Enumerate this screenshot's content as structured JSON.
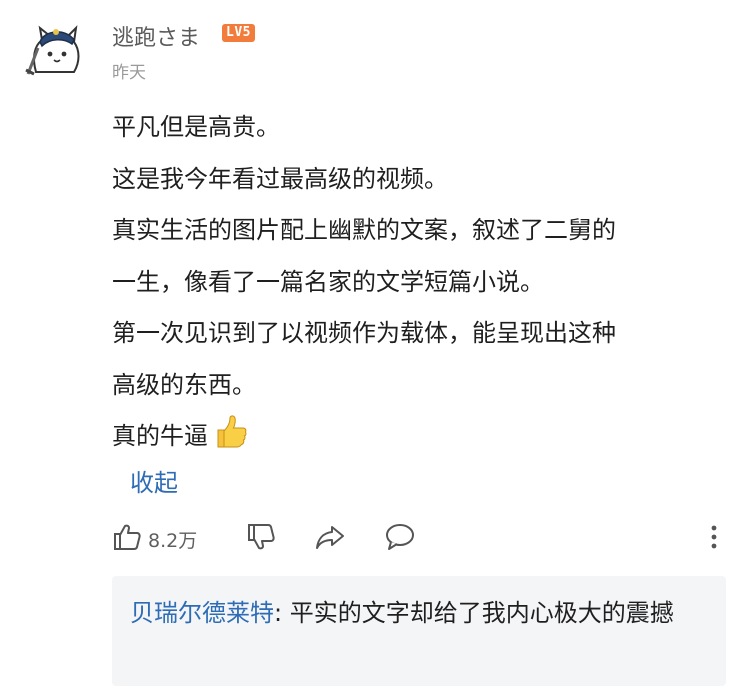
{
  "comment": {
    "username": "逃跑さま",
    "level_badge": "LV5",
    "timestamp": "昨天",
    "lines": [
      "平凡但是高贵。",
      "这是我今年看过最高级的视频。",
      "真实生活的图片配上幽默的文案，叙述了二舅的",
      "一生，像看了一篇名家的文学短篇小说。",
      "第一次见识到了以视频作为载体，能呈现出这种",
      "高级的东西。",
      "真的牛逼"
    ],
    "emoji": "thumbs-up-emoji",
    "collapse_label": "收起"
  },
  "actions": {
    "like_count": "8.2万",
    "icons": [
      "thumbs-up-icon",
      "thumbs-down-icon",
      "share-icon",
      "comment-icon",
      "more-vertical-icon"
    ]
  },
  "reply": {
    "author": "贝瑞尔德莱特",
    "separator": ": ",
    "text": "平实的文字却给了我内心极大的震撼"
  },
  "colors": {
    "link_blue": "#2e6cb5",
    "level_badge": "#f17c3c",
    "reply_background": "#f4f5f7"
  }
}
